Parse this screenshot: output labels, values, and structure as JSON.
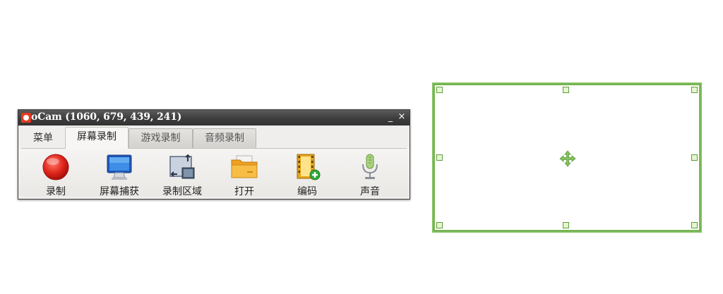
{
  "window": {
    "title": "oCam (1060, 679, 439, 241)",
    "minimize": "_",
    "close": "×"
  },
  "tabs": [
    {
      "label": "菜单"
    },
    {
      "label": "屏幕录制",
      "active": true
    },
    {
      "label": "游戏录制"
    },
    {
      "label": "音频录制"
    }
  ],
  "toolbar": [
    {
      "label": "录制",
      "icon": "record-icon"
    },
    {
      "label": "屏幕捕获",
      "icon": "monitor-icon"
    },
    {
      "label": "录制区域",
      "icon": "resize-area-icon"
    },
    {
      "label": "打开",
      "icon": "folder-icon"
    },
    {
      "label": "编码",
      "icon": "film-codec-icon"
    },
    {
      "label": "声音",
      "icon": "microphone-icon"
    }
  ],
  "region": {
    "accent_color": "#84c160"
  }
}
